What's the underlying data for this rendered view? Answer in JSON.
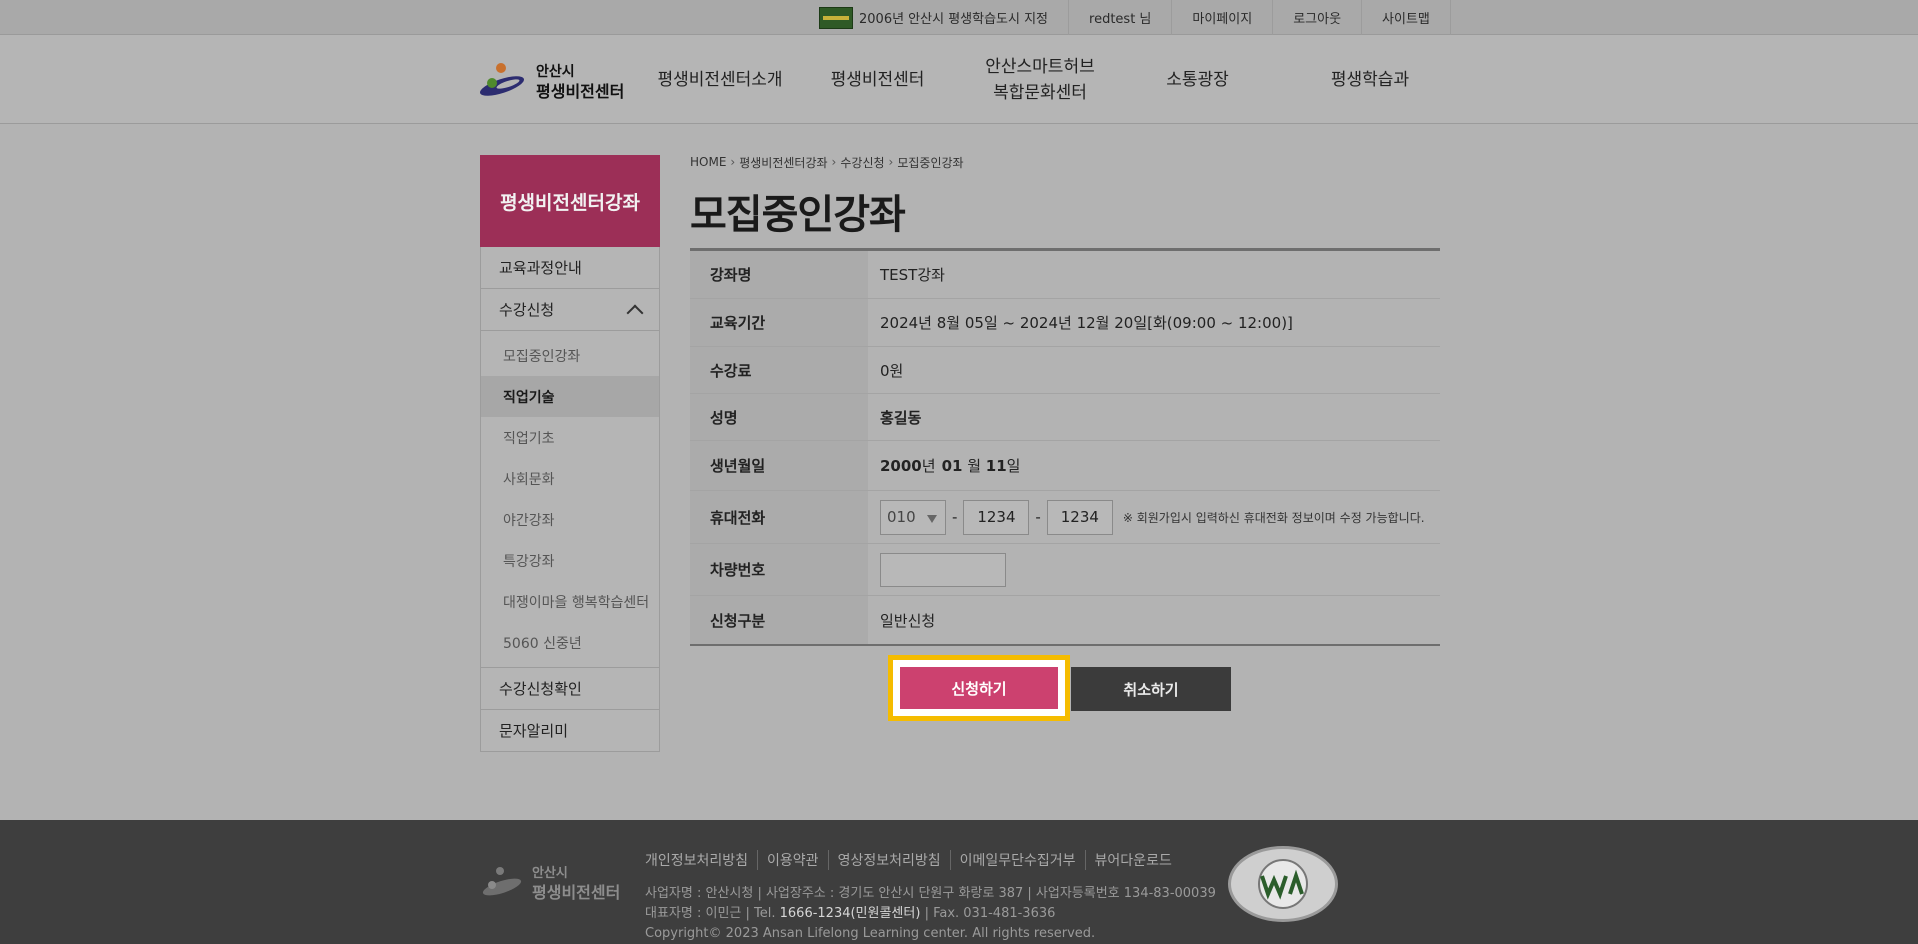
{
  "topbar": {
    "badge_text": "2006년 안산시 평생학습도시 지정",
    "user": "redtest 님",
    "mypage": "마이페이지",
    "logout": "로그아웃",
    "sitemap": "사이트맵"
  },
  "header": {
    "logo_line1": "안산시",
    "logo_line2": "평생비전센터",
    "nav": [
      {
        "label": "평생비전센터소개"
      },
      {
        "label": "평생비전센터"
      },
      {
        "label": "안산스마트허브\n복합문화센터",
        "line1": "안산스마트허브",
        "line2": "복합문화센터"
      },
      {
        "label": "소통광장"
      },
      {
        "label": "평생학습과"
      }
    ]
  },
  "sidebar": {
    "title": "평생비전센터강좌",
    "items": [
      {
        "label": "교육과정안내"
      },
      {
        "label": "수강신청"
      },
      {
        "label": "수강신청확인"
      },
      {
        "label": "문자알리미"
      }
    ],
    "sub_items": [
      {
        "label": "모집중인강좌"
      },
      {
        "label": "직업기술"
      },
      {
        "label": "직업기초"
      },
      {
        "label": "사회문화"
      },
      {
        "label": "야간강좌"
      },
      {
        "label": "특강강좌"
      },
      {
        "label": "대쟁이마을 행복학습센터"
      },
      {
        "label": "5060 신중년"
      }
    ]
  },
  "breadcrumb": [
    "HOME",
    "평생비전센터강좌",
    "수강신청",
    "모집중인강좌"
  ],
  "page_title": "모집중인강좌",
  "form": {
    "course_name": {
      "label": "강좌명",
      "value": "TEST강좌"
    },
    "period": {
      "label": "교육기간",
      "value": "2024년 8월 05일 ~ 2024년 12월 20일[화(09:00 ~ 12:00)]"
    },
    "fee": {
      "label": "수강료",
      "value": "0원"
    },
    "name": {
      "label": "성명",
      "value": "홍길동"
    },
    "birth": {
      "label": "생년월일",
      "year": "2000",
      "y_unit": "년",
      "month": "01",
      "m_unit": " 월 ",
      "day": "11",
      "d_unit": "일"
    },
    "phone": {
      "label": "휴대전화",
      "prefix": "010",
      "mid": "1234",
      "last": "1234",
      "note": "※ 회원가입시 입력하신 휴대전화 정보이며 수정 가능합니다."
    },
    "car": {
      "label": "차량번호",
      "value": ""
    },
    "type": {
      "label": "신청구분",
      "value": "일반신청"
    }
  },
  "buttons": {
    "apply": "신청하기",
    "cancel": "취소하기"
  },
  "footer": {
    "logo_line1": "안산시",
    "logo_line2": "평생비전센터",
    "links": [
      "개인정보처리방침",
      "이용약관",
      "영상정보처리방침",
      "이메일무단수집거부",
      "뷰어다운로드"
    ],
    "info_line1": "사업자명 : 안산시청 | 사업장주소 : 경기도 안산시 단원구 화랑로 387 | 사업자등록번호 134-83-00039",
    "info_line2_pre": "대표자명 : 이민근 | Tel. ",
    "info_line2_tel": "1666-1234(민원콜센터)",
    "info_line2_post": " | Fax. 031-481-3636",
    "copyright": "Copyright© 2023 Ansan Lifelong Learning center. All rights reserved."
  },
  "colors": {
    "sidebar_title_bg": "#9c2f57",
    "apply_button": "#cc416f",
    "highlight": "#f5bc00",
    "cancel_button": "#3b3b3b",
    "footer_bg": "#3e3e3e"
  }
}
